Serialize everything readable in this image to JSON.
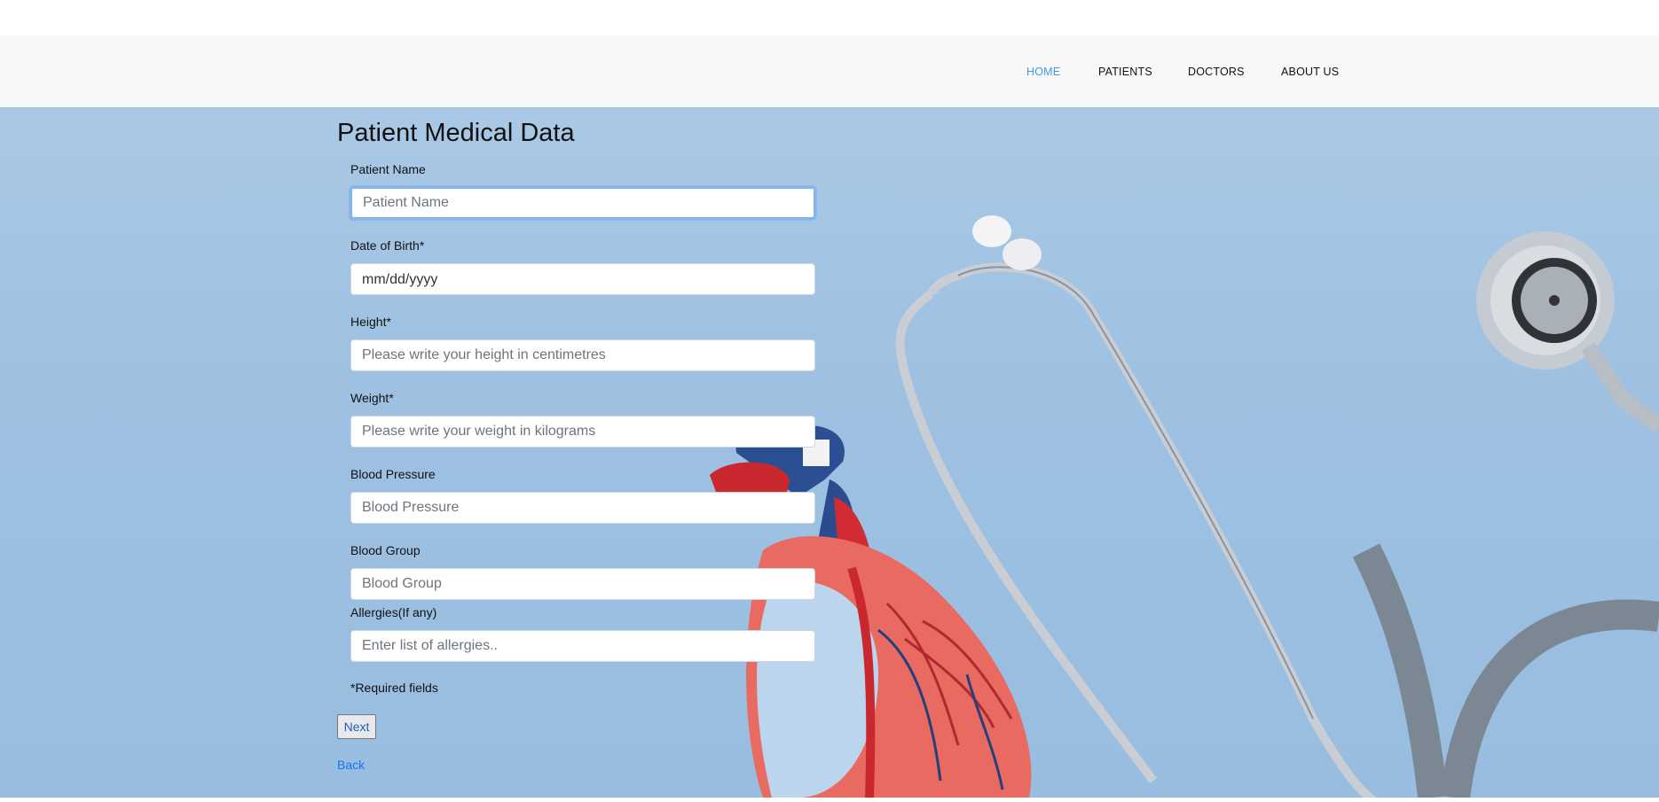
{
  "nav": {
    "items": [
      {
        "label": "HOME",
        "active": true
      },
      {
        "label": "PATIENTS",
        "active": false
      },
      {
        "label": "DOCTORS",
        "active": false
      },
      {
        "label": "ABOUT US",
        "active": false
      }
    ]
  },
  "form": {
    "title": "Patient Medical Data",
    "fields": [
      {
        "label": "Patient Name",
        "placeholder": "Patient Name"
      },
      {
        "label": "Date of Birth*",
        "placeholder": "mm/dd/yyyy"
      },
      {
        "label": "Height*",
        "placeholder": "Please write your height in centimetres"
      },
      {
        "label": "Weight*",
        "placeholder": "Please write your weight in kilograms"
      },
      {
        "label": "Blood Pressure",
        "placeholder": "Blood Pressure"
      },
      {
        "label": "Blood Group",
        "placeholder": "Blood Group"
      },
      {
        "label": "Allergies(If any)",
        "placeholder": "Enter list of allergies.."
      }
    ],
    "required_note": "*Required fields",
    "next_label": "Next",
    "back_label": "Back"
  },
  "colors": {
    "nav_active": "#3d9be9",
    "background": "#a3c4e3",
    "link": "#1a73e8"
  },
  "icons": [
    "stethoscope-illustration",
    "heart-model-illustration"
  ]
}
